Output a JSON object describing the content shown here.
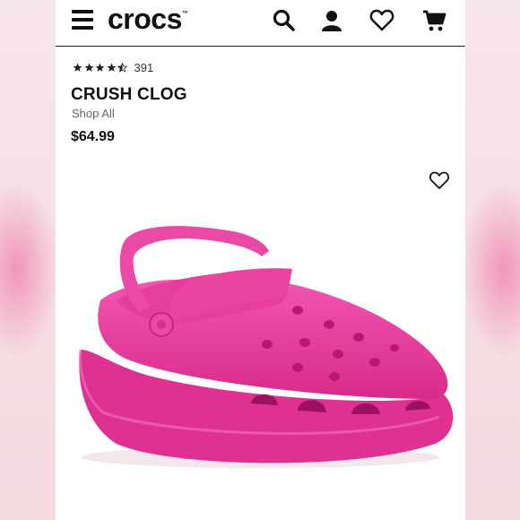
{
  "header": {
    "logo_text": "crocs",
    "icons": [
      "menu-icon",
      "search-icon",
      "account-icon",
      "heart-icon",
      "cart-icon"
    ]
  },
  "product": {
    "rating_stars": 4.5,
    "review_count": "391",
    "name": "CRUSH CLOG",
    "category_link": "Shop All",
    "price": "$64.99",
    "color": "#e8399c"
  },
  "colors": {
    "accent_pink": "#e8399c",
    "text": "#111111"
  }
}
